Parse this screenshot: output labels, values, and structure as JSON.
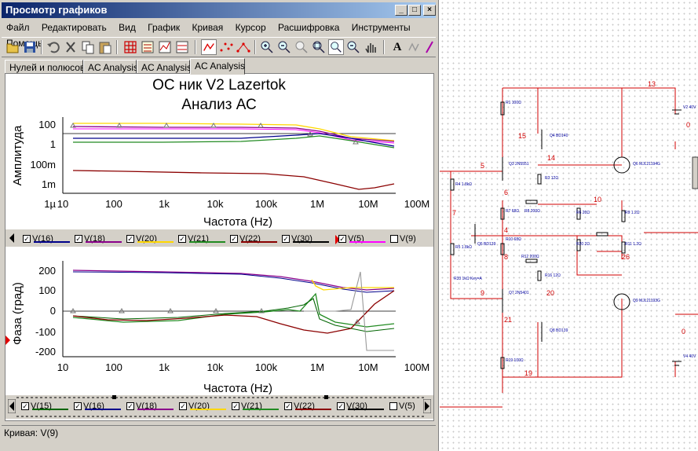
{
  "window": {
    "title": "Просмотр графиков",
    "controls": {
      "minimize": "_",
      "maximize": "□",
      "close": "×"
    }
  },
  "menu": [
    "Файл",
    "Редактировать",
    "Вид",
    "График",
    "Кривая",
    "Курсор",
    "Расшифровка",
    "Инструменты",
    "Помощь"
  ],
  "toolbar_icons": [
    "open-icon",
    "save-icon",
    "undo-icon",
    "cut-icon",
    "copy-icon",
    "paste-icon",
    "grid-icon",
    "legend-icon",
    "split-icon",
    "split2-icon",
    "line-icon",
    "dots-icon",
    "markers-icon",
    "zoom-in-icon",
    "zoom-out-icon",
    "zoom-box-icon",
    "zoom-fit-icon",
    "zoom-full-icon",
    "pan-icon",
    "text-icon",
    "signal-icon",
    "pen-icon"
  ],
  "tabs": [
    "Нулей и полюсов",
    "AC Analysis",
    "AC Analysis",
    "AC Analysis"
  ],
  "active_tab": 3,
  "graph": {
    "title_line1": "ОС ник V2 Lazertok",
    "title_line2": "Анализ АС",
    "xlabel": "Частота (Hz)",
    "top_ylabel": "Амплитуда",
    "bottom_ylabel": "Фаза (град)",
    "x_ticks": [
      "10",
      "100",
      "1k",
      "10k",
      "100k",
      "1M",
      "10M",
      "100M"
    ],
    "top_y_ticks": [
      "100",
      "1",
      "100m",
      "1m",
      "1µ"
    ],
    "bottom_y_ticks": [
      "200",
      "100",
      "0",
      "-100",
      "-200"
    ]
  },
  "legend_top": [
    {
      "label": "V(16)",
      "checked": true,
      "color": "#00008b"
    },
    {
      "label": "V(18)",
      "checked": true,
      "color": "#8b008b"
    },
    {
      "label": "V(20)",
      "checked": true,
      "color": "#ffd700"
    },
    {
      "label": "V(21)",
      "checked": true,
      "color": "#228b22"
    },
    {
      "label": "V(22)",
      "checked": true,
      "color": "#8b0000"
    },
    {
      "label": "V(30)",
      "checked": true,
      "color": "#000000"
    },
    {
      "label": "V(5)",
      "checked": true,
      "color": "#ff00ff"
    },
    {
      "label": "V(9)",
      "checked": false,
      "color": "#ffffff"
    }
  ],
  "legend_bottom": [
    {
      "label": "V(15)",
      "checked": true,
      "color": "#006400"
    },
    {
      "label": "V(16)",
      "checked": true,
      "color": "#00008b"
    },
    {
      "label": "V(18)",
      "checked": true,
      "color": "#8b008b"
    },
    {
      "label": "V(20)",
      "checked": true,
      "color": "#ffd700"
    },
    {
      "label": "V(21)",
      "checked": true,
      "color": "#228b22"
    },
    {
      "label": "V(22)",
      "checked": true,
      "color": "#8b0000"
    },
    {
      "label": "V(30)",
      "checked": true,
      "color": "#000000"
    },
    {
      "label": "V(5)",
      "checked": false,
      "color": "#ffffff"
    }
  ],
  "status": "Кривая: V(9)",
  "schematic": {
    "nodes": [
      "13",
      "15",
      "14",
      "5",
      "6",
      "10",
      "7",
      "4",
      "8",
      "9",
      "20",
      "21",
      "19",
      "26"
    ],
    "components": [
      "R1 100Ω",
      "Q4 BD140",
      "Q3 2N5551",
      "R3 12Ω",
      "R4 1.8kΩ",
      "Q5 BD139",
      "R5 1.8kΩ",
      "Q6 MJL21194G",
      "R7 68Ω",
      "R8 200Ω",
      "R6 20Ω",
      "R9 1.2Ω",
      "R10 68Ω",
      "R11 1.2Ω",
      "R20 2Ω",
      "R12 200Ω",
      "R16 12Ω",
      "Q7 2N5401",
      "Q8 BD139",
      "Q9 MJL21193G",
      "R19 100Ω",
      "V2 40V",
      "V4 40V",
      "R33 1kΩ Key=A"
    ],
    "labels_0": [
      "0",
      "0"
    ]
  }
}
